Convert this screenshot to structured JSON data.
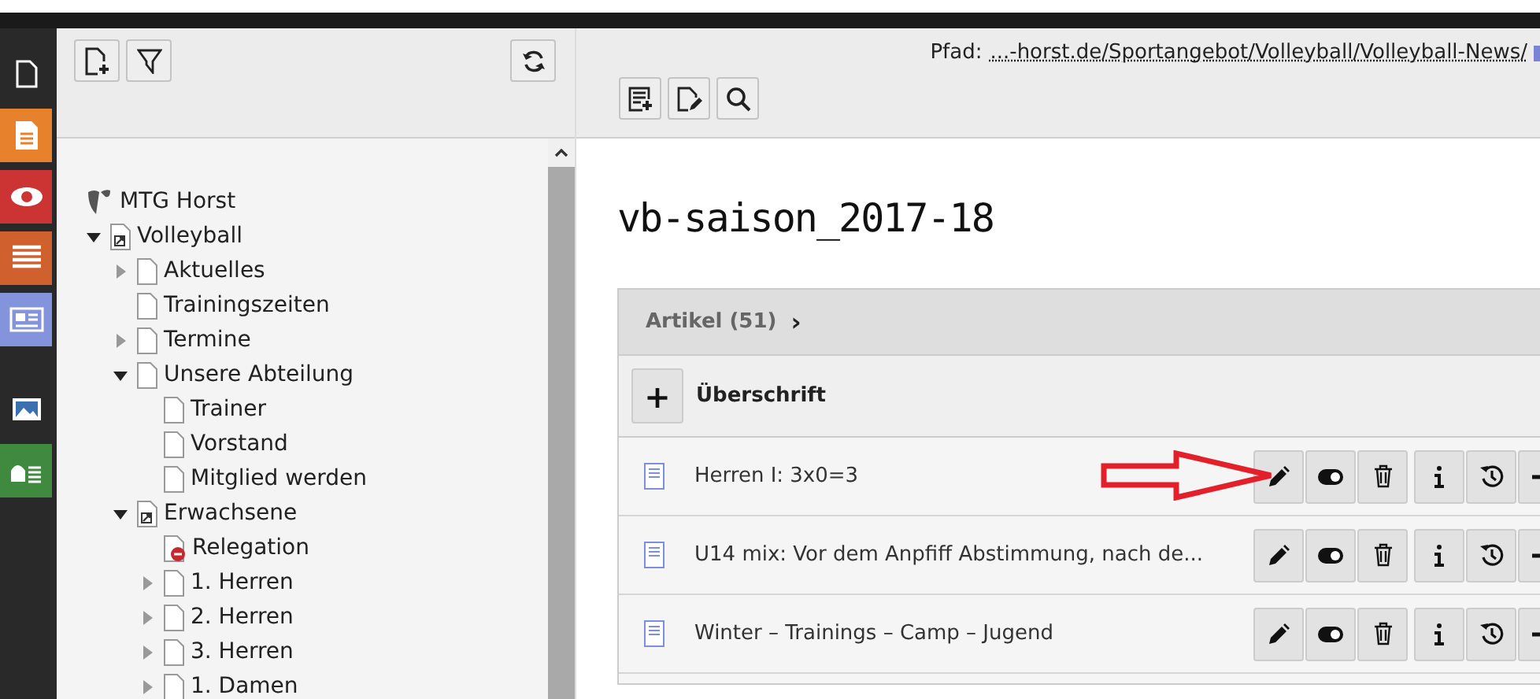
{
  "modules": [
    {
      "kind": "page",
      "color": "#292929"
    },
    {
      "kind": "list",
      "color": "#e8812c"
    },
    {
      "kind": "view",
      "color": "#cc3333"
    },
    {
      "kind": "records",
      "color": "#d0602d"
    },
    {
      "kind": "news",
      "color": "#8494dc"
    },
    {
      "kind": "image",
      "color": "#292929"
    },
    {
      "kind": "forms",
      "color": "#3f8a3f"
    }
  ],
  "tree_toolbar": {
    "buttons": [
      {
        "kind": "new-page"
      },
      {
        "kind": "filter"
      },
      {
        "kind": "refresh"
      }
    ]
  },
  "tree": [
    {
      "label": "MTG Horst",
      "kind": "root",
      "children": [
        {
          "label": "Volleyball",
          "kind": "shortcut",
          "expanded": true,
          "children": [
            {
              "label": "Aktuelles",
              "kind": "page",
              "expanded": false
            },
            {
              "label": "Trainingszeiten",
              "kind": "page"
            },
            {
              "label": "Termine",
              "kind": "page",
              "expanded": false
            },
            {
              "label": "Unsere Abteilung",
              "kind": "page",
              "expanded": true,
              "children": [
                {
                  "label": "Trainer",
                  "kind": "page"
                },
                {
                  "label": "Vorstand",
                  "kind": "page"
                },
                {
                  "label": "Mitglied werden",
                  "kind": "page"
                }
              ]
            },
            {
              "label": "Erwachsene",
              "kind": "shortcut",
              "expanded": true,
              "children": [
                {
                  "label": "Relegation",
                  "kind": "restricted"
                },
                {
                  "label": "1. Herren",
                  "kind": "page",
                  "expanded": false
                },
                {
                  "label": "2. Herren",
                  "kind": "page",
                  "expanded": false
                },
                {
                  "label": "3. Herren",
                  "kind": "page",
                  "expanded": false
                },
                {
                  "label": "1. Damen",
                  "kind": "page",
                  "expanded": false
                }
              ]
            }
          ]
        }
      ]
    }
  ],
  "path": {
    "label": "Pfad:",
    "link": "...-horst.de/Sportangebot/Volleyball/Volleyball-News/"
  },
  "doc_toolbar": {
    "buttons": [
      {
        "kind": "new-record"
      },
      {
        "kind": "edit-page"
      },
      {
        "kind": "search"
      }
    ]
  },
  "title": "vb-saison_2017-18",
  "panel": {
    "header": "Artikel (51)",
    "chevron": "›",
    "new_button": "+",
    "new_label": "Überschrift",
    "rows": [
      {
        "title": "Herren I: 3x0=3",
        "annotated": true
      },
      {
        "title": "U14 mix: Vor dem Anpfiff Abstimmung, nach de...",
        "annotated": false
      },
      {
        "title": "Winter – Trainings – Camp – Jugend",
        "annotated": false
      }
    ]
  }
}
